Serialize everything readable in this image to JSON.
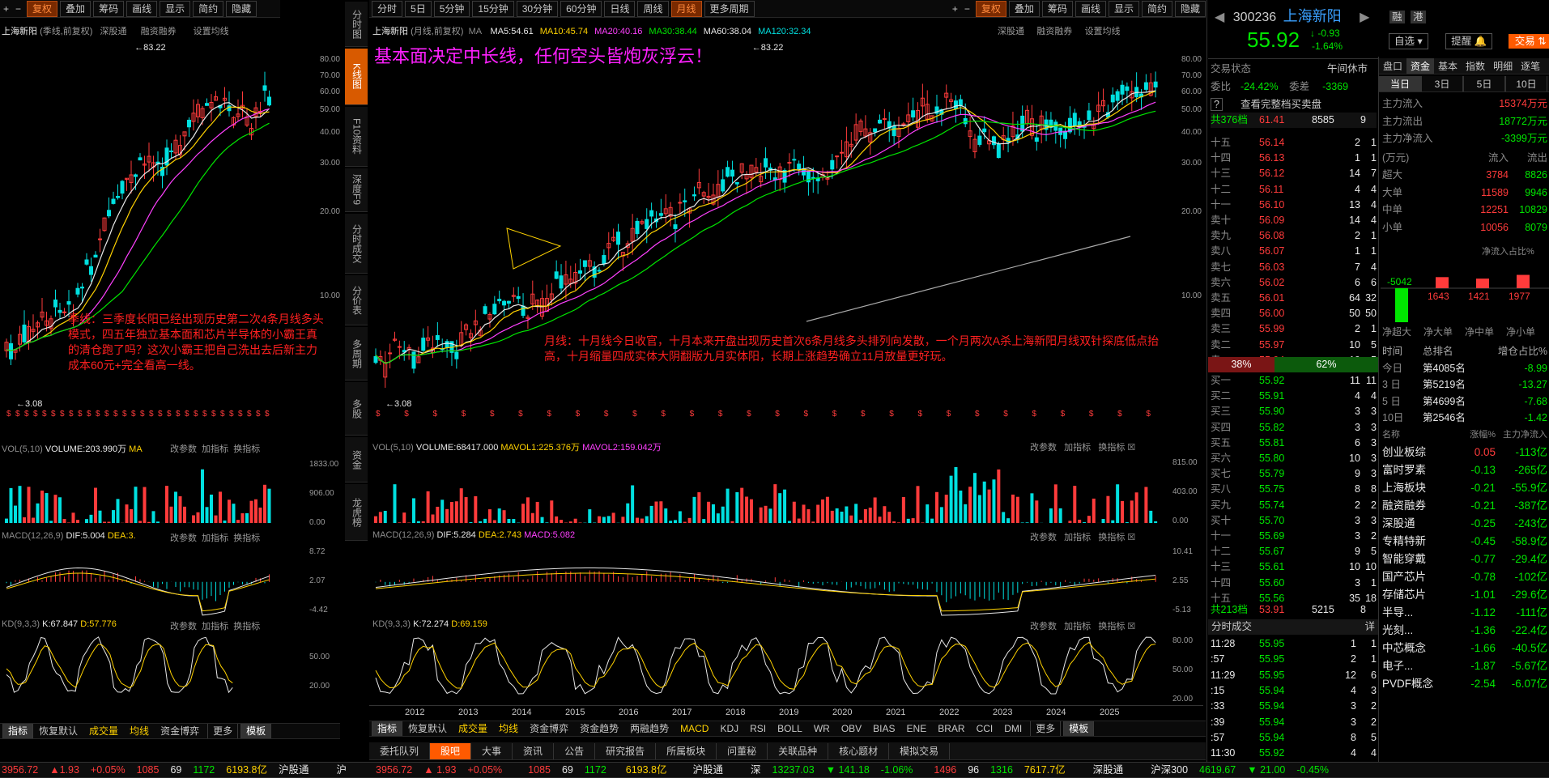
{
  "top_left": {
    "tabs": [
      "复权",
      "叠加",
      "筹码",
      "画线",
      "显示",
      "简约",
      "隐藏"
    ],
    "active": 0
  },
  "top_main": {
    "period_tabs": [
      "分时",
      "5日",
      "5分钟",
      "15分钟",
      "30分钟",
      "60分钟",
      "日线",
      "周线",
      "月线",
      "更多周期"
    ],
    "active": 8,
    "right_tabs": [
      "复权",
      "叠加",
      "筹码",
      "画线",
      "显示",
      "简约",
      "隐藏"
    ]
  },
  "left_chart": {
    "title": "上海新阳",
    "subtitle": "(季线,前复权)",
    "links": [
      "深股通",
      "融资融券",
      "设置均线"
    ],
    "max_label": "83.22",
    "min_label": "3.08",
    "yaxis": [
      "80.00",
      "70.00",
      "60.00",
      "50.00",
      "40.00",
      "30.00",
      "20.00",
      "10.00"
    ],
    "annotation": "季线：三季度长阳已经出现历史第二次4条月线多头模式，四五年独立基本面和芯片半导体的小霸王真的清仓跑了吗？这次小霸王把自己洗出去后新主力成本60元+完全看高一线。",
    "vol": {
      "label": "VOL(5,10)",
      "value": "VOLUME:203.990万",
      "ma": "MA",
      "y": [
        "1833.00",
        "906.00",
        "0.00"
      ]
    },
    "macd": {
      "label": "MACD(12,26,9)",
      "dif": "DIF:5.004",
      "dea": "DEA:3.",
      "y": [
        "8.72",
        "2.07",
        "-4.42"
      ]
    },
    "kd": {
      "label": "KD(9,3,3)",
      "k": "K:67.847",
      "d": "D:57.776",
      "y": [
        "50.00",
        "20.00"
      ]
    },
    "tools": [
      "改参数",
      "加指标",
      "换指标"
    ],
    "bottom_tabs": [
      "指标",
      "恢复默认",
      "成交量",
      "均线",
      "资金博弈",
      "更多",
      "模板"
    ]
  },
  "vtabs": [
    "分时图",
    "K线图",
    "F10资料",
    "深度F9",
    "分时成交",
    "分价表",
    "多周期",
    "多股",
    "资金",
    "龙虎榜"
  ],
  "vtab_active": 1,
  "main_chart": {
    "title": "上海新阳",
    "subtitle": "(月线,前复权)",
    "ma": [
      {
        "t": "MA5:54.61",
        "c": "#e8e8e8"
      },
      {
        "t": "MA10:45.74",
        "c": "#ffd200"
      },
      {
        "t": "MA20:40.16",
        "c": "#ff40ff"
      },
      {
        "t": "MA30:38.44",
        "c": "#00e600"
      },
      {
        "t": "MA60:38.04",
        "c": "#e8e8e8"
      },
      {
        "t": "MA120:32.34",
        "c": "#00e0e0"
      }
    ],
    "links": [
      "深股通",
      "融资融券",
      "设置均线"
    ],
    "headline": "基本面决定中长线，任何空头皆炮灰浮云！",
    "annotation": "月线：十月线今日收官，十月本来开盘出现历史首次6条月线多头排列向发散，一个月两次A杀上海新阳月线双针探底低点抬高，十月缩量四成实体大阴翻版九月实体阳，长期上涨趋势确立11月放量更好玩。",
    "max_label": "83.22",
    "min_label": "3.08",
    "yaxis": [
      "80.00",
      "70.00",
      "60.00",
      "50.00",
      "40.00",
      "30.00",
      "20.00",
      "10.00"
    ],
    "vol": {
      "label": "VOL(5,10)",
      "value": "VOLUME:68417.000",
      "ma1": "MAVOL1:225.376万",
      "ma2": "MAVOL2:159.042万",
      "y": [
        "815.00",
        "403.00",
        "0.00"
      ]
    },
    "macd": {
      "label": "MACD(12,26,9)",
      "dif": "DIF:5.284",
      "dea": "DEA:2.743",
      "macd": "MACD:5.082",
      "y": [
        "10.41",
        "2.55",
        "-5.13"
      ]
    },
    "kd": {
      "label": "KD(9,3,3)",
      "k": "K:72.274",
      "d": "D:69.159",
      "y": [
        "80.00",
        "50.00",
        "20.00"
      ]
    },
    "tools": [
      "改参数",
      "加指标",
      "换指标"
    ],
    "years": [
      "2012",
      "2013",
      "2014",
      "2015",
      "2016",
      "2017",
      "2018",
      "2019",
      "2020",
      "2021",
      "2022",
      "2023",
      "2024",
      "2025"
    ],
    "bottom_tabs": [
      "指标",
      "恢复默认",
      "成交量",
      "均线",
      "资金博弈",
      "资金趋势",
      "两融趋势",
      "MACD",
      "KDJ",
      "RSI",
      "BOLL",
      "WR",
      "OBV",
      "BIAS",
      "ENE",
      "BRAR",
      "CCI",
      "DMI",
      "更多",
      "模板"
    ]
  },
  "bottom_nav": [
    "委托队列",
    "股吧",
    "大事",
    "资讯",
    "公告",
    "研究报告",
    "所属板块",
    "问董秘",
    "关联品种",
    "核心题材",
    "模拟交易"
  ],
  "bottom_nav_active": 1,
  "status": {
    "left": [
      "3956.72",
      "1.93",
      "+0.05%",
      "1085",
      "69",
      "1172",
      "6193.8亿"
    ],
    "sh": "沪股通",
    "items": [
      "沪",
      "3956.72",
      "1.93",
      "+0.05%",
      "1085",
      "69",
      "1172",
      "6193.8亿",
      "沪股通",
      "深",
      "13237.03",
      "141.18",
      "-1.06%",
      "1496",
      "96",
      "1316",
      "7617.7亿",
      "深股通",
      "沪深300",
      "4619.67",
      "21.00",
      "-0.45%"
    ]
  },
  "quote": {
    "code": "300236",
    "name": "上海新阳",
    "price": "55.92",
    "chg": "-0.93",
    "pct": "-1.64%",
    "tags": [
      "融",
      "港"
    ],
    "buttons": [
      "自选",
      "提醒",
      "交易"
    ],
    "status_label": "交易状态",
    "status_value": "午间休市",
    "weibi_label": "委比",
    "weibi": "-24.42%",
    "weicha_label": "委差",
    "weicha": "-3369",
    "full_book": "查看完整档买卖盘",
    "total_sell_label": "共376档",
    "total_sell_price": "61.41",
    "total_sell_vol": "8585",
    "total_sell_n": "9",
    "sells": [
      [
        "十五",
        "56.14",
        "2",
        "1"
      ],
      [
        "十四",
        "56.13",
        "1",
        "1"
      ],
      [
        "十三",
        "56.12",
        "14",
        "7"
      ],
      [
        "十二",
        "56.11",
        "4",
        "4"
      ],
      [
        "十一",
        "56.10",
        "13",
        "4"
      ],
      [
        "卖十",
        "56.09",
        "14",
        "4"
      ],
      [
        "卖九",
        "56.08",
        "2",
        "1"
      ],
      [
        "卖八",
        "56.07",
        "1",
        "1"
      ],
      [
        "卖七",
        "56.03",
        "7",
        "4"
      ],
      [
        "卖六",
        "56.02",
        "6",
        "6"
      ],
      [
        "卖五",
        "56.01",
        "64",
        "32"
      ],
      [
        "卖四",
        "56.00",
        "50",
        "50"
      ],
      [
        "卖三",
        "55.99",
        "2",
        "1"
      ],
      [
        "卖二",
        "55.97",
        "10",
        "5"
      ],
      [
        "卖一",
        "55.94",
        "19",
        "5"
      ]
    ],
    "ratio_l": "38%",
    "ratio_r": "62%",
    "buys": [
      [
        "买一",
        "55.92",
        "11",
        "11"
      ],
      [
        "买二",
        "55.91",
        "4",
        "4"
      ],
      [
        "买三",
        "55.90",
        "3",
        "3"
      ],
      [
        "买四",
        "55.82",
        "3",
        "3"
      ],
      [
        "买五",
        "55.81",
        "6",
        "3"
      ],
      [
        "买六",
        "55.80",
        "10",
        "3"
      ],
      [
        "买七",
        "55.79",
        "9",
        "3"
      ],
      [
        "买八",
        "55.75",
        "8",
        "8"
      ],
      [
        "买九",
        "55.74",
        "2",
        "2"
      ],
      [
        "买十",
        "55.70",
        "3",
        "3"
      ],
      [
        "十一",
        "55.69",
        "3",
        "2"
      ],
      [
        "十二",
        "55.67",
        "9",
        "5"
      ],
      [
        "十三",
        "55.61",
        "10",
        "10"
      ],
      [
        "十四",
        "55.60",
        "3",
        "1"
      ],
      [
        "十五",
        "55.56",
        "35",
        "18"
      ]
    ],
    "total_buy_label": "共213档",
    "total_buy_price": "53.91",
    "total_buy_vol": "5215",
    "total_buy_n": "8",
    "ticks_title": "分时成交",
    "ticks_detail": "详",
    "ticks": [
      [
        "11:28",
        "55.95",
        "1",
        "1"
      ],
      [
        ":57",
        "55.95",
        "2",
        "1"
      ],
      [
        "11:29",
        "55.95",
        "12",
        "6"
      ],
      [
        ":15",
        "55.94",
        "4",
        "3"
      ],
      [
        ":33",
        "55.94",
        "3",
        "2"
      ],
      [
        ":39",
        "55.94",
        "3",
        "2"
      ],
      [
        ":57",
        "55.94",
        "8",
        "5"
      ],
      [
        "11:30",
        "55.92",
        "4",
        "4"
      ]
    ]
  },
  "fund": {
    "tabs": [
      "盘口",
      "资金",
      "基本",
      "指数",
      "明细",
      "逐笔"
    ],
    "active": 1,
    "period_tabs": [
      "当日",
      "3日",
      "5日",
      "10日"
    ],
    "rows": [
      [
        "主力流入",
        "15374万元"
      ],
      [
        "主力流出",
        "18772万元"
      ],
      [
        "主力净流入",
        "-3399万元"
      ]
    ],
    "head": [
      "(万元)",
      "流入",
      "流出"
    ],
    "detail": [
      [
        "超大",
        "3784",
        "8826"
      ],
      [
        "大单",
        "11589",
        "9946"
      ],
      [
        "中单",
        "12251",
        "10829"
      ],
      [
        "小单",
        "10056",
        "8079"
      ]
    ],
    "net_title": "净流入占比%",
    "net_values": [
      -5042,
      1643,
      1421,
      1977
    ],
    "net_labels": [
      "净超大",
      "净大单",
      "净中单",
      "净小单"
    ],
    "rank_head": [
      "时间",
      "总排名",
      "增仓占比%"
    ],
    "ranks": [
      [
        "今日",
        "第4085名",
        "-8.99"
      ],
      [
        "3 日",
        "第5219名",
        "-13.27"
      ],
      [
        "5 日",
        "第4699名",
        "-7.68"
      ],
      [
        "10日",
        "第2546名",
        "-1.42"
      ]
    ],
    "sector_head": [
      "名称",
      "涨幅%",
      "主力净流入"
    ],
    "sectors": [
      [
        "创业板综",
        "0.05",
        "-113亿"
      ],
      [
        "富时罗素",
        "-0.13",
        "-265亿"
      ],
      [
        "上海板块",
        "-0.21",
        "-55.9亿"
      ],
      [
        "融资融券",
        "-0.21",
        "-387亿"
      ],
      [
        "深股通",
        "-0.25",
        "-243亿"
      ],
      [
        "专精特新",
        "-0.45",
        "-58.9亿"
      ],
      [
        "智能穿戴",
        "-0.77",
        "-29.4亿"
      ],
      [
        "国产芯片",
        "-0.78",
        "-102亿"
      ],
      [
        "存储芯片",
        "-1.01",
        "-29.6亿"
      ],
      [
        "半导...",
        "-1.12",
        "-111亿"
      ],
      [
        "光刻...",
        "-1.36",
        "-22.4亿"
      ],
      [
        "中芯概念",
        "-1.66",
        "-40.5亿"
      ],
      [
        "电子...",
        "-1.87",
        "-5.67亿"
      ],
      [
        "PVDF概念",
        "-2.54",
        "-6.07亿"
      ]
    ]
  }
}
